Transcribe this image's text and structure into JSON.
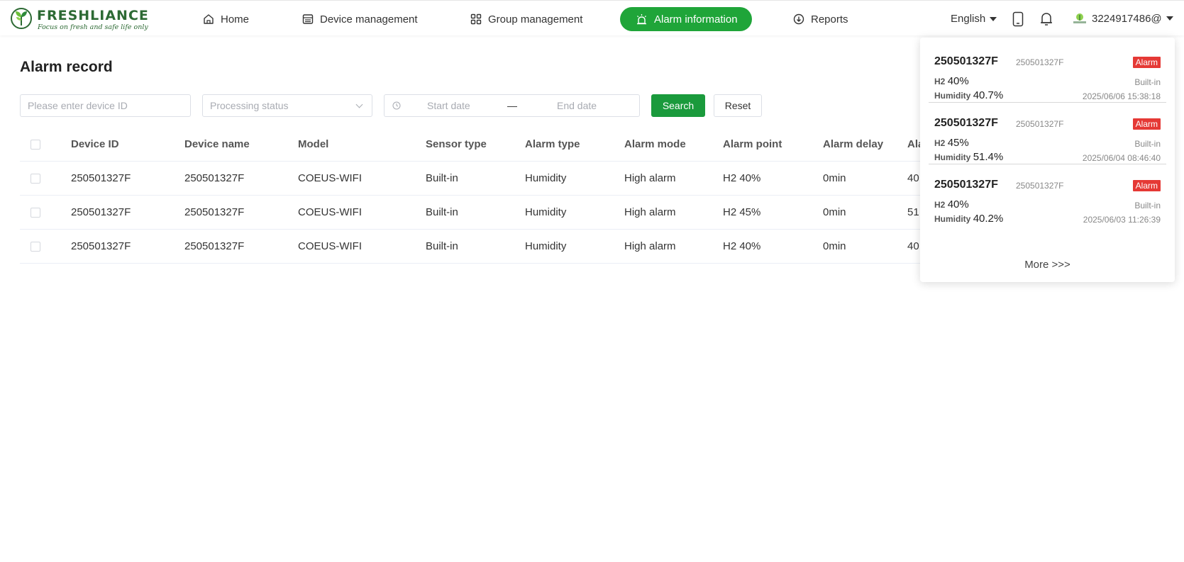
{
  "brand": {
    "name": "FRESHLIANCE",
    "tagline": "Focus on fresh and safe life only",
    "accent": "#1fa539"
  },
  "nav": {
    "home": "Home",
    "device": "Device management",
    "group": "Group management",
    "alarm": "Alarm information",
    "reports": "Reports"
  },
  "header": {
    "language": "English",
    "username": "3224917486@"
  },
  "page": {
    "title": "Alarm record"
  },
  "filters": {
    "device_placeholder": "Please enter device ID",
    "status_placeholder": "Processing status",
    "start_date": "Start date",
    "separator": "—",
    "end_date": "End date",
    "search": "Search",
    "reset": "Reset"
  },
  "table": {
    "columns": [
      "Device ID",
      "Device name",
      "Model",
      "Sensor type",
      "Alarm type",
      "Alarm mode",
      "Alarm point",
      "Alarm delay",
      "Ala"
    ],
    "rows": [
      [
        "250501327F",
        "250501327F",
        "COEUS-WIFI",
        "Built-in",
        "Humidity",
        "High alarm",
        "H2 40%",
        "0min",
        "40"
      ],
      [
        "250501327F",
        "250501327F",
        "COEUS-WIFI",
        "Built-in",
        "Humidity",
        "High alarm",
        "H2 45%",
        "0min",
        "51"
      ],
      [
        "250501327F",
        "250501327F",
        "COEUS-WIFI",
        "Built-in",
        "Humidity",
        "High alarm",
        "H2 40%",
        "0min",
        "40"
      ]
    ]
  },
  "notifications": {
    "items": [
      {
        "id": "250501327F",
        "name": "250501327F",
        "badge": "Alarm",
        "point_label": "H2",
        "point_value": "40%",
        "metric_label": "Humidity",
        "metric_value": "40.7%",
        "sensor": "Built-in",
        "time": "2025/06/06 15:38:18"
      },
      {
        "id": "250501327F",
        "name": "250501327F",
        "badge": "Alarm",
        "point_label": "H2",
        "point_value": "45%",
        "metric_label": "Humidity",
        "metric_value": "51.4%",
        "sensor": "Built-in",
        "time": "2025/06/04 08:46:40"
      },
      {
        "id": "250501327F",
        "name": "250501327F",
        "badge": "Alarm",
        "point_label": "H2",
        "point_value": "40%",
        "metric_label": "Humidity",
        "metric_value": "40.2%",
        "sensor": "Built-in",
        "time": "2025/06/03 11:26:39"
      }
    ],
    "more": "More >>>"
  }
}
